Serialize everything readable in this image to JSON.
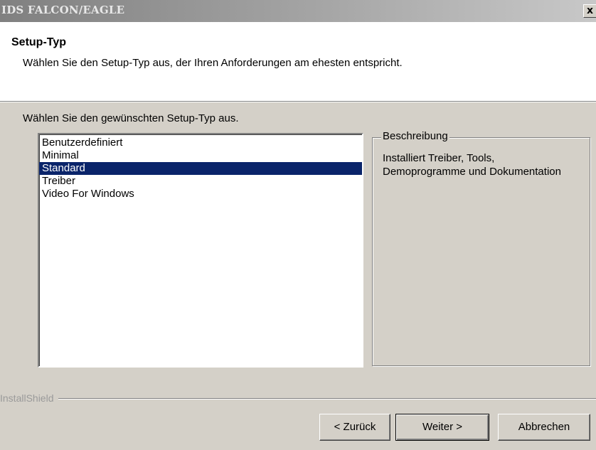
{
  "window": {
    "title": "IDS FALCON/EAGLE",
    "close_label": "x"
  },
  "header": {
    "title": "Setup-Typ",
    "description": "Wählen Sie den Setup-Typ aus, der Ihren Anforderungen am ehesten entspricht."
  },
  "main": {
    "prompt": "Wählen Sie den gewünschten Setup-Typ aus.",
    "setup_types": [
      {
        "label": "Benutzerdefiniert",
        "selected": false
      },
      {
        "label": "Minimal",
        "selected": false
      },
      {
        "label": "Standard",
        "selected": true
      },
      {
        "label": "Treiber",
        "selected": false
      },
      {
        "label": "Video For Windows",
        "selected": false
      }
    ],
    "description_group": {
      "legend": "Beschreibung",
      "text": "Installiert Treiber, Tools, Demoprogramme und Dokumentation"
    }
  },
  "footer": {
    "brand": "InstallShield",
    "back_label": "< Zurück",
    "next_label": "Weiter >",
    "cancel_label": "Abbrechen"
  },
  "colors": {
    "selection": "#0a246a",
    "dialog_background": "#d4d0c8"
  }
}
